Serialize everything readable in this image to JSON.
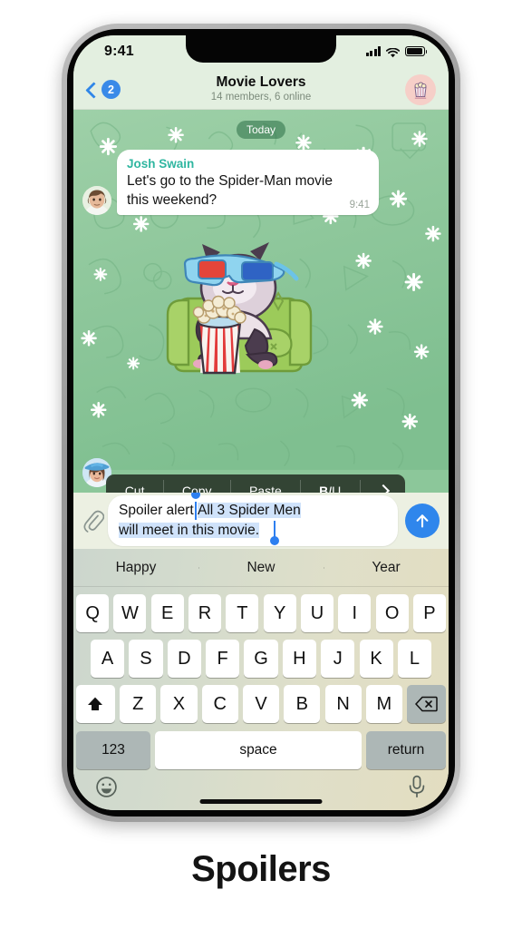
{
  "caption": "Spoilers",
  "status_bar": {
    "time": "9:41",
    "cellular_icon": "signal-bars-icon",
    "wifi_icon": "wifi-icon",
    "battery_icon": "battery-icon"
  },
  "header": {
    "back_icon": "chevron-left-icon",
    "unread_badge": "2",
    "title": "Movie Lovers",
    "subtitle": "14 members, 6 online",
    "group_avatar_icon": "popcorn-avatar-icon"
  },
  "chat": {
    "date_chip": "Today",
    "message": {
      "sender": "Josh Swain",
      "text_line1": "Let's go to the Spider-Man movie",
      "text_line2": "this weekend?",
      "time": "9:41",
      "avatar_icon": "user-avatar-josh"
    },
    "sticker": {
      "name": "cat-3d-glasses-popcorn-sticker",
      "avatar_icon": "user-avatar-woman-hat"
    }
  },
  "context_menu": {
    "items": [
      {
        "label": "Cut",
        "name": "cut"
      },
      {
        "label": "Copy",
        "name": "copy"
      },
      {
        "label": "Paste",
        "name": "paste"
      }
    ],
    "format": {
      "bold": "B",
      "italic": "I",
      "underline": "U"
    },
    "more_icon": "chevron-right-icon"
  },
  "input_bar": {
    "attach_icon": "paperclip-icon",
    "unselected_text": "Spoiler alert:",
    "selected_line1": "All 3 Spider Men",
    "selected_line2": "will meet in this movie.",
    "send_icon": "arrow-up-icon",
    "accent_color": "#2f86ec",
    "selection_color": "#cfe2fa"
  },
  "keyboard": {
    "suggestions": [
      "Happy",
      "New",
      "Year"
    ],
    "row1": [
      "Q",
      "W",
      "E",
      "R",
      "T",
      "Y",
      "U",
      "I",
      "O",
      "P"
    ],
    "row2": [
      "A",
      "S",
      "D",
      "F",
      "G",
      "H",
      "J",
      "K",
      "L"
    ],
    "row3_letters": [
      "Z",
      "X",
      "C",
      "V",
      "B",
      "N",
      "M"
    ],
    "shift_icon": "shift-arrow-icon",
    "delete_icon": "backspace-icon",
    "numbers_key": "123",
    "space_key": "space",
    "return_key": "return",
    "emoji_icon": "smiley-icon",
    "mic_icon": "microphone-icon"
  }
}
